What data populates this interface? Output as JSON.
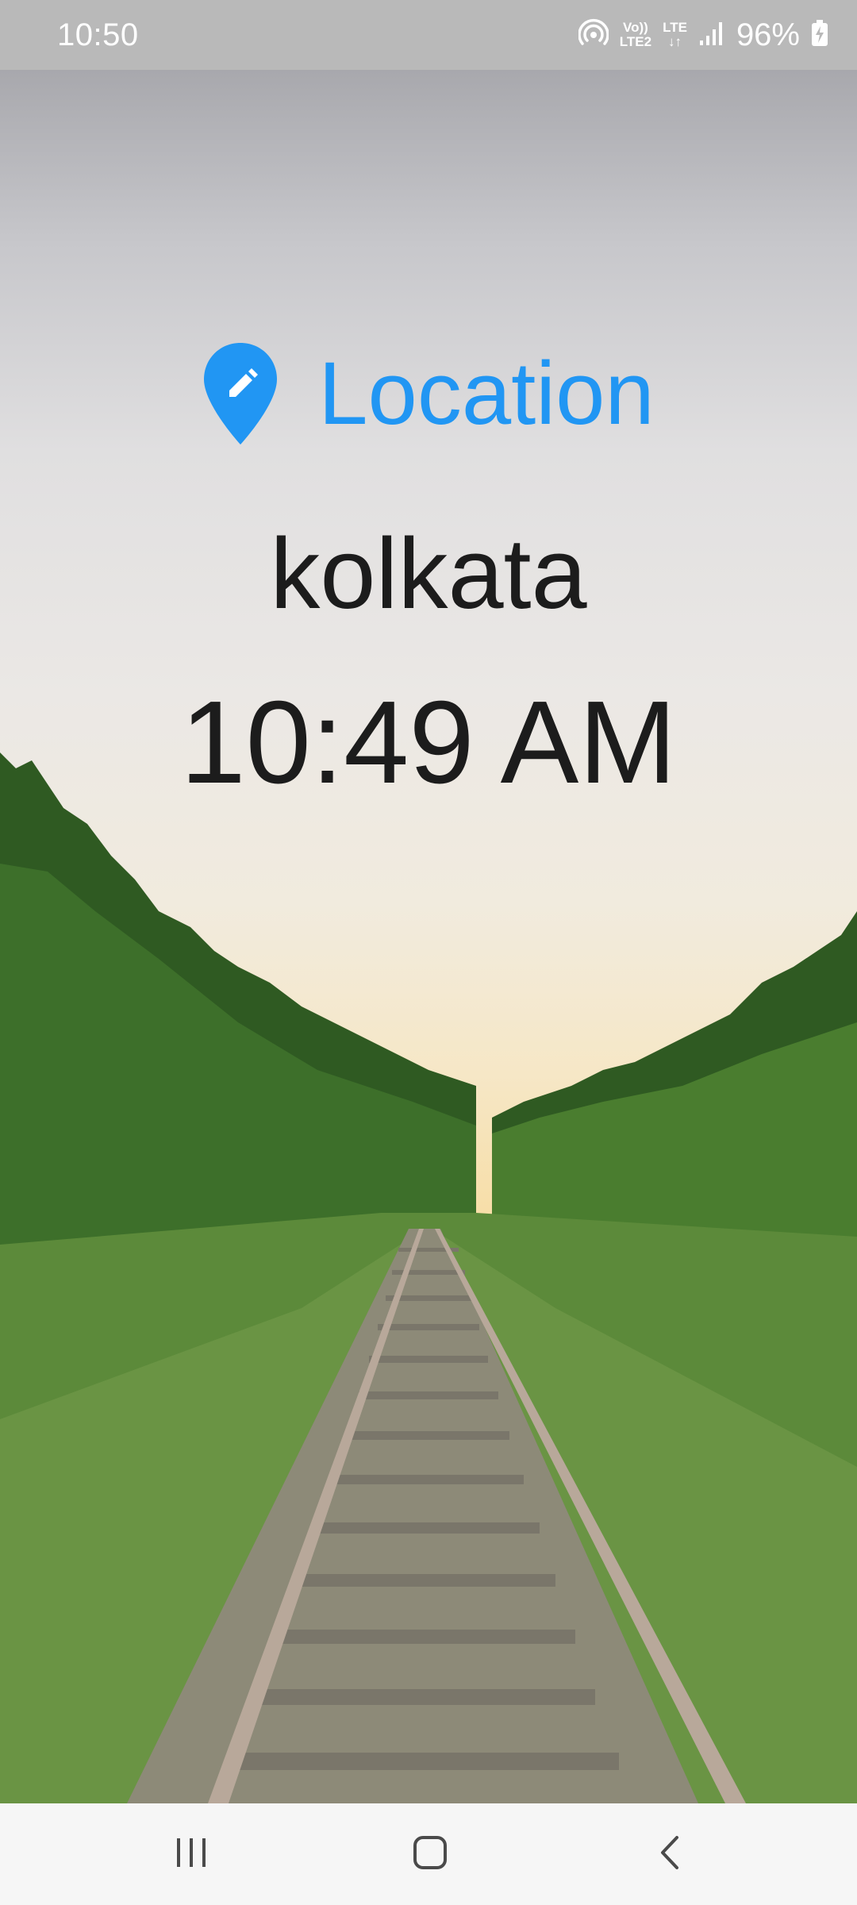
{
  "status_bar": {
    "time": "10:50",
    "volte_top": "Vo))",
    "volte_bottom": "LTE2",
    "lte_label": "LTE",
    "lte_arrows": "↓↑",
    "battery_percent": "96%",
    "icons": [
      "hotspot-icon",
      "volte-icon",
      "lte-data-icon",
      "signal-icon",
      "battery-charging-icon"
    ]
  },
  "main": {
    "location_label": "Location",
    "location_icon": "location-pin-edit-icon",
    "city": "kolkata",
    "time": "10:49 AM",
    "accent_color": "#2196f3",
    "text_color": "#1c1c1c",
    "background": "railway-track-through-forest-at-sunset"
  },
  "nav_bar": {
    "buttons": [
      "recents-icon",
      "home-icon",
      "back-icon"
    ]
  }
}
